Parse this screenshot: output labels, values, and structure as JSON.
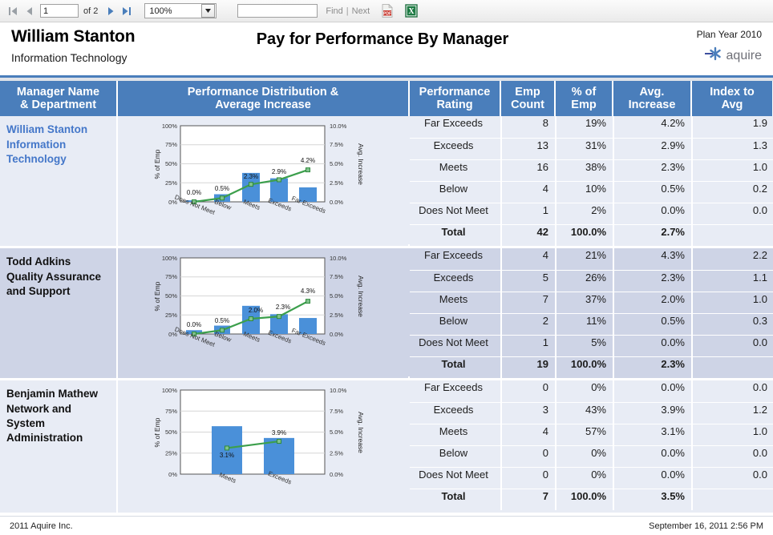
{
  "toolbar": {
    "first_page_icon": "first-page-icon",
    "prev_page_icon": "previous-page-icon",
    "page_value": "1",
    "of_label": "of 2",
    "next_page_icon": "next-page-icon",
    "last_page_icon": "last-page-icon",
    "zoom_value": "100%",
    "find_value": "",
    "find_placeholder": "",
    "find_label": "Find",
    "separator": "|",
    "next_label": "Next",
    "pdf_export_icon": "pdf-export-icon",
    "excel_export_icon": "excel-export-icon"
  },
  "header": {
    "manager_name": "William Stanton",
    "department": "Information Technology",
    "title": "Pay for Performance By Manager",
    "plan_year": "Plan Year 2010",
    "logo_text": "aquire",
    "logo_icon": "aquire-asterisk-logo"
  },
  "columns": [
    "Manager Name\n& Department",
    "Performance Distribution &\nAverage Increase",
    "Performance\nRating",
    "Emp\nCount",
    "% of\nEmp",
    "Avg.\nIncrease",
    "Index to\nAvg"
  ],
  "columns_lines": {
    "c0a": "Manager Name",
    "c0b": "& Department",
    "c1a": "Performance Distribution &",
    "c1b": "Average Increase",
    "c2a": "Performance",
    "c2b": "Rating",
    "c3a": "Emp",
    "c3b": "Count",
    "c4a": "% of",
    "c4b": "Emp",
    "c5a": "Avg.",
    "c5b": "Increase",
    "c6a": "Index to",
    "c6b": "Avg"
  },
  "sections": [
    {
      "manager": "William Stanton",
      "department_lines": "Information\nTechnology",
      "dept_line1": "Information",
      "dept_line2": "Technology",
      "is_link": true,
      "rows": [
        {
          "rating": "Far Exceeds",
          "count": "8",
          "pct": "19%",
          "avg": "4.2%",
          "index": "1.9"
        },
        {
          "rating": "Exceeds",
          "count": "13",
          "pct": "31%",
          "avg": "2.9%",
          "index": "1.3"
        },
        {
          "rating": "Meets",
          "count": "16",
          "pct": "38%",
          "avg": "2.3%",
          "index": "1.0"
        },
        {
          "rating": "Below",
          "count": "4",
          "pct": "10%",
          "avg": "0.5%",
          "index": "0.2"
        },
        {
          "rating": "Does Not Meet",
          "count": "1",
          "pct": "2%",
          "avg": "0.0%",
          "index": "0.0"
        },
        {
          "rating": "Total",
          "count": "42",
          "pct": "100.0%",
          "avg": "2.7%",
          "index": ""
        }
      ]
    },
    {
      "manager": "Todd Adkins",
      "department_lines": "Quality Assurance\nand Support",
      "dept_line1": "Quality Assurance",
      "dept_line2": "and Support",
      "is_link": false,
      "rows": [
        {
          "rating": "Far Exceeds",
          "count": "4",
          "pct": "21%",
          "avg": "4.3%",
          "index": "2.2"
        },
        {
          "rating": "Exceeds",
          "count": "5",
          "pct": "26%",
          "avg": "2.3%",
          "index": "1.1"
        },
        {
          "rating": "Meets",
          "count": "7",
          "pct": "37%",
          "avg": "2.0%",
          "index": "1.0"
        },
        {
          "rating": "Below",
          "count": "2",
          "pct": "11%",
          "avg": "0.5%",
          "index": "0.3"
        },
        {
          "rating": "Does Not Meet",
          "count": "1",
          "pct": "5%",
          "avg": "0.0%",
          "index": "0.0"
        },
        {
          "rating": "Total",
          "count": "19",
          "pct": "100.0%",
          "avg": "2.3%",
          "index": ""
        }
      ]
    },
    {
      "manager": "Benjamin Mathew",
      "department_lines": "Network and\nSystem\nAdministration",
      "dept_line1": "Network and",
      "dept_line2": "System",
      "dept_line3": "Administration",
      "is_link": false,
      "rows": [
        {
          "rating": "Far Exceeds",
          "count": "0",
          "pct": "0%",
          "avg": "0.0%",
          "index": "0.0"
        },
        {
          "rating": "Exceeds",
          "count": "3",
          "pct": "43%",
          "avg": "3.9%",
          "index": "1.2"
        },
        {
          "rating": "Meets",
          "count": "4",
          "pct": "57%",
          "avg": "3.1%",
          "index": "1.0"
        },
        {
          "rating": "Below",
          "count": "0",
          "pct": "0%",
          "avg": "0.0%",
          "index": "0.0"
        },
        {
          "rating": "Does Not Meet",
          "count": "0",
          "pct": "0%",
          "avg": "0.0%",
          "index": "0.0"
        },
        {
          "rating": "Total",
          "count": "7",
          "pct": "100.0%",
          "avg": "3.5%",
          "index": ""
        }
      ]
    }
  ],
  "chart_data": [
    {
      "type": "bar",
      "title": "Performance Distribution & Average Increase",
      "manager": "William Stanton",
      "categories": [
        "Does Not Meet",
        "Below",
        "Meets",
        "Exceeds",
        "Far Exceeds"
      ],
      "series": [
        {
          "name": "% of Emp",
          "type": "bar",
          "values": [
            2,
            10,
            38,
            31,
            19
          ],
          "axis": "left",
          "color": "#4a90d9"
        },
        {
          "name": "Avg. Increase",
          "type": "line",
          "values": [
            0.0,
            0.5,
            2.3,
            2.9,
            4.2
          ],
          "axis": "right",
          "color": "#3c9f4c",
          "labels": [
            "0.0%",
            "0.5%",
            "2.3%",
            "2.9%",
            "4.2%"
          ]
        }
      ],
      "ylabel": "% of Emp",
      "y2label": "Avg. Increase",
      "ylim": [
        0,
        100
      ],
      "y2lim": [
        0,
        10
      ],
      "yticks": [
        "0%",
        "25%",
        "50%",
        "75%",
        "100%"
      ],
      "y2ticks": [
        "0.0%",
        "2.5%",
        "5.0%",
        "7.5%",
        "10.0%"
      ],
      "grid": true,
      "legend": "none"
    },
    {
      "type": "bar",
      "title": "Performance Distribution & Average Increase",
      "manager": "Todd Adkins",
      "categories": [
        "Does Not Meet",
        "Below",
        "Meets",
        "Exceeds",
        "Far Exceeds"
      ],
      "series": [
        {
          "name": "% of Emp",
          "type": "bar",
          "values": [
            5,
            11,
            37,
            26,
            21
          ],
          "axis": "left",
          "color": "#4a90d9"
        },
        {
          "name": "Avg. Increase",
          "type": "line",
          "values": [
            0.0,
            0.5,
            2.0,
            2.3,
            4.3
          ],
          "axis": "right",
          "color": "#3c9f4c",
          "labels": [
            "0.0%",
            "0.5%",
            "2.0%",
            "2.3%",
            "4.3%"
          ]
        }
      ],
      "ylabel": "% of Emp",
      "y2label": "Avg. Increase",
      "ylim": [
        0,
        100
      ],
      "y2lim": [
        0,
        10
      ],
      "yticks": [
        "0%",
        "25%",
        "50%",
        "75%",
        "100%"
      ],
      "y2ticks": [
        "0.0%",
        "2.5%",
        "5.0%",
        "7.5%",
        "10.0%"
      ],
      "grid": true,
      "legend": "none"
    },
    {
      "type": "bar",
      "title": "Performance Distribution & Average Increase",
      "manager": "Benjamin Mathew",
      "categories": [
        "Meets",
        "Exceeds"
      ],
      "series": [
        {
          "name": "% of Emp",
          "type": "bar",
          "values": [
            57,
            43
          ],
          "axis": "left",
          "color": "#4a90d9"
        },
        {
          "name": "Avg. Increase",
          "type": "line",
          "values": [
            3.1,
            3.9
          ],
          "axis": "right",
          "color": "#3c9f4c",
          "labels": [
            "3.1%",
            "3.9%"
          ]
        }
      ],
      "ylabel": "% of Emp",
      "y2label": "Avg. Increase",
      "ylim": [
        0,
        100
      ],
      "y2lim": [
        0,
        10
      ],
      "yticks": [
        "0%",
        "25%",
        "50%",
        "75%",
        "100%"
      ],
      "y2ticks": [
        "0.0%",
        "2.5%",
        "5.0%",
        "7.5%",
        "10.0%"
      ],
      "grid": true,
      "legend": "none"
    }
  ],
  "footer": {
    "copyright": "2011 Aquire Inc.",
    "timestamp": "September 16, 2011 2:56 PM"
  },
  "colors": {
    "header_blue": "#4a7ebb",
    "bar_blue": "#4a90d9",
    "line_green": "#3c9f4c",
    "band_light": "#e8ecf5",
    "band_dark": "#ced4e6",
    "link_blue": "#4477c9"
  }
}
